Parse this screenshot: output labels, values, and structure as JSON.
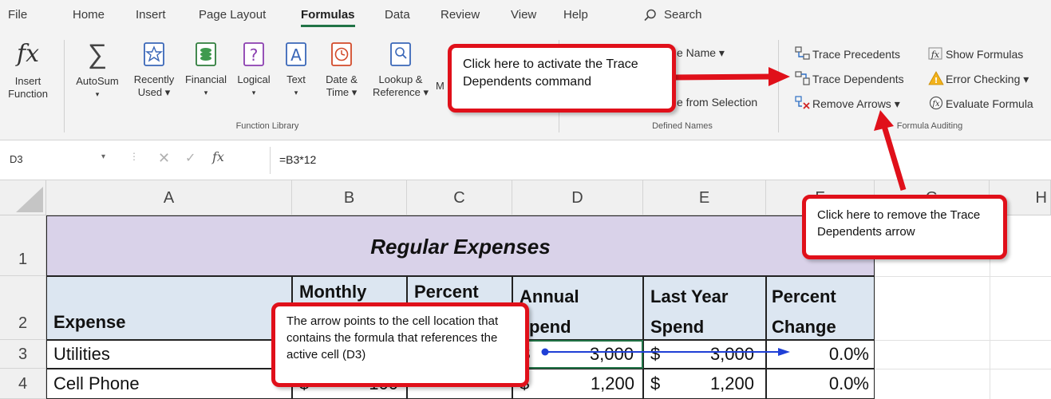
{
  "menu": {
    "tabs": [
      "File",
      "Home",
      "Insert",
      "Page Layout",
      "Formulas",
      "Data",
      "Review",
      "View",
      "Help"
    ],
    "search": "Search"
  },
  "ribbon": {
    "insert_function": {
      "line1": "Insert",
      "line2": "Function"
    },
    "autosum": "AutoSum",
    "recently_used": {
      "line1": "Recently",
      "line2": "Used"
    },
    "financial": "Financial",
    "logical": "Logical",
    "text": "Text",
    "date_time": {
      "line1": "Date &",
      "line2": "Time"
    },
    "lookup_reference": {
      "line1": "Lookup &",
      "line2": "Reference"
    },
    "math_partial": "M",
    "function_library_label": "Function Library",
    "define_name": "e Name",
    "create_from_selection": "e from Selection",
    "defined_names_label": "Defined Names",
    "trace_precedents": "Trace Precedents",
    "trace_dependents": "Trace Dependents",
    "remove_arrows": "Remove Arrows",
    "show_formulas": "Show Formulas",
    "error_checking": "Error Checking",
    "evaluate_formula": "Evaluate Formula",
    "formula_auditing_label": "Formula Auditing"
  },
  "formula_bar": {
    "name_box": "D3",
    "formula": "=B3*12"
  },
  "grid": {
    "columns": [
      "A",
      "B",
      "C",
      "D",
      "E",
      "F",
      "G",
      "H"
    ],
    "rows": [
      "1",
      "2",
      "3",
      "4"
    ],
    "title": "Regular Expenses",
    "headers": {
      "expense": "Expense",
      "monthly": "Monthly",
      "percent_of": "Percent",
      "annual1": "Annual",
      "annual2": "pend",
      "lastyear1": "Last Year",
      "lastyear2": "Spend",
      "change1": "Percent",
      "change2": "Change"
    },
    "r3": {
      "expense": "Utilities",
      "d_cur": "$",
      "d_val": "3,000",
      "e_cur": "$",
      "e_val": "3,000",
      "f_val": "0.0%"
    },
    "r4": {
      "expense": "Cell Phone",
      "b_cur": "$",
      "b_val": "100",
      "d_cur": "$",
      "d_val": "1,200",
      "e_cur": "$",
      "e_val": "1,200",
      "f_val": "0.0%"
    }
  },
  "callouts": {
    "trace_dependents": "Click here to activate the Trace Dependents command",
    "remove_arrow": "Click here to remove the Trace Dependents arrow",
    "arrow_points": "The arrow points to the cell location that contains the formula that references the active cell (D3)"
  },
  "colors": {
    "accent_green": "#217346",
    "callout_red": "#e0101a",
    "title_fill": "#d9d2e9",
    "header_fill": "#dce6f1",
    "trace_arrow": "#1f3fd6"
  }
}
